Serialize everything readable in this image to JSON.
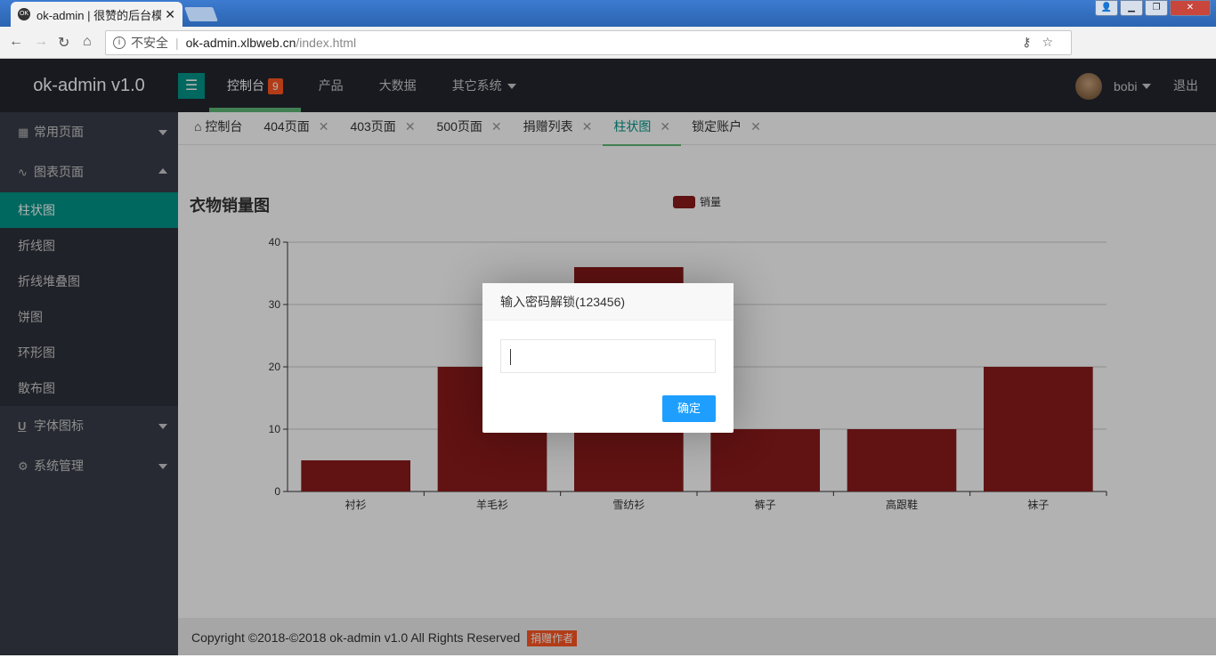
{
  "browser": {
    "tab_title": "ok-admin | 很赞的后台模",
    "tab_favicon": "OK",
    "security_label": "不安全",
    "url_domain": "ok-admin.xlbweb.cn",
    "url_path": "/index.html"
  },
  "header": {
    "logo": "ok-admin v1.0",
    "nav": [
      {
        "label": "控制台",
        "badge": "9"
      },
      {
        "label": "产品"
      },
      {
        "label": "大数据"
      },
      {
        "label": "其它系统"
      }
    ],
    "user": "bobi",
    "logout": "退出"
  },
  "sidebar": {
    "groups": [
      {
        "label": "常用页面",
        "icon": "calendar-icon"
      },
      {
        "label": "图表页面",
        "icon": "pulse-icon"
      },
      {
        "label": "字体图标",
        "icon": "underline-icon"
      },
      {
        "label": "系统管理",
        "icon": "gear-icon"
      }
    ],
    "chart_items": [
      "柱状图",
      "折线图",
      "折线堆叠图",
      "饼图",
      "环形图",
      "散布图"
    ]
  },
  "tabs": [
    "控制台",
    "404页面",
    "403页面",
    "500页面",
    "捐赠列表",
    "柱状图",
    "锁定账户"
  ],
  "chart_data": {
    "type": "bar",
    "title": "衣物销量图",
    "categories": [
      "衬衫",
      "羊毛衫",
      "雪纺衫",
      "裤子",
      "高跟鞋",
      "袜子"
    ],
    "series": [
      {
        "name": "销量",
        "values": [
          5,
          20,
          36,
          10,
          10,
          20
        ],
        "color": "#8b1a1a"
      }
    ],
    "yticks": [
      "0",
      "10",
      "20",
      "30",
      "40"
    ],
    "ylim": [
      0,
      40
    ],
    "legend": "top-center",
    "grid": true
  },
  "footer": {
    "text": "Copyright ©2018-©2018 ok-admin v1.0 All Rights Reserved",
    "donate": "捐赠作者"
  },
  "dialog": {
    "title": "输入密码解锁(123456)",
    "input_value": "",
    "confirm": "确定"
  }
}
